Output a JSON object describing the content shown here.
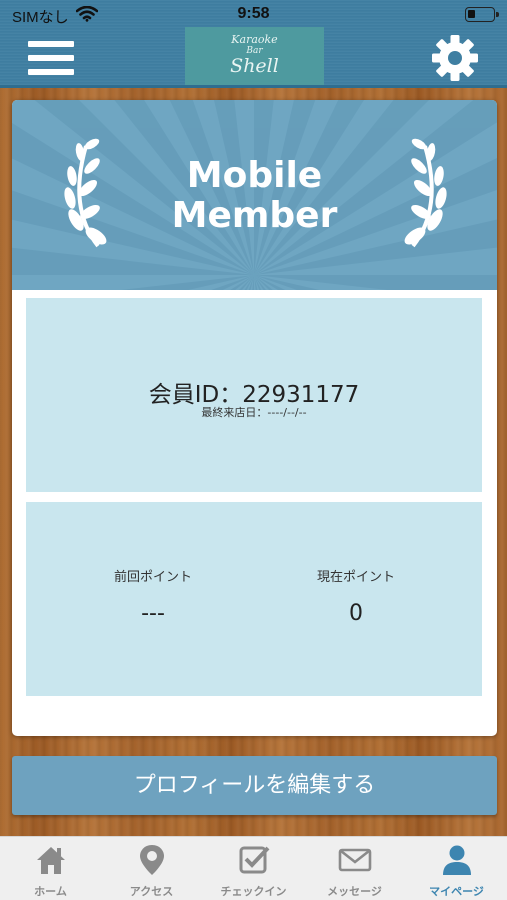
{
  "status_bar": {
    "carrier": "SIMなし",
    "time": "9:58",
    "battery_level": 0.3
  },
  "header": {
    "logo": {
      "line1": "Karaoke",
      "line2": "Bar",
      "line3": "Shell"
    },
    "menu_icon": "hamburger-icon",
    "settings_icon": "gear-icon",
    "colors": {
      "header_bg": "#3f7fa2",
      "logo_bg": "#4e9a9f"
    }
  },
  "member_card": {
    "banner_title_line1": "Mobile",
    "banner_title_line2": "Member",
    "member_id_text": "会員ID：22931177",
    "last_visit_text": "最終来店日：----/--/--",
    "previous_points_label": "前回ポイント",
    "previous_points_value": "---",
    "current_points_label": "現在ポイント",
    "current_points_value": "0",
    "colors": {
      "banner": "#6fa6c2",
      "panel": "#c9e6ee"
    }
  },
  "edit_profile_button": "プロフィールを編集する",
  "tabbar": {
    "items": [
      {
        "label": "ホーム",
        "icon": "home-icon",
        "active": false
      },
      {
        "label": "アクセス",
        "icon": "map-pin-icon",
        "active": false
      },
      {
        "label": "チェックイン",
        "icon": "checkbox-icon",
        "active": false
      },
      {
        "label": "メッセージ",
        "icon": "envelope-icon",
        "active": false
      },
      {
        "label": "マイページ",
        "icon": "user-icon",
        "active": true
      }
    ],
    "colors": {
      "inactive": "#8a8a8a",
      "active": "#3d85b0"
    }
  }
}
